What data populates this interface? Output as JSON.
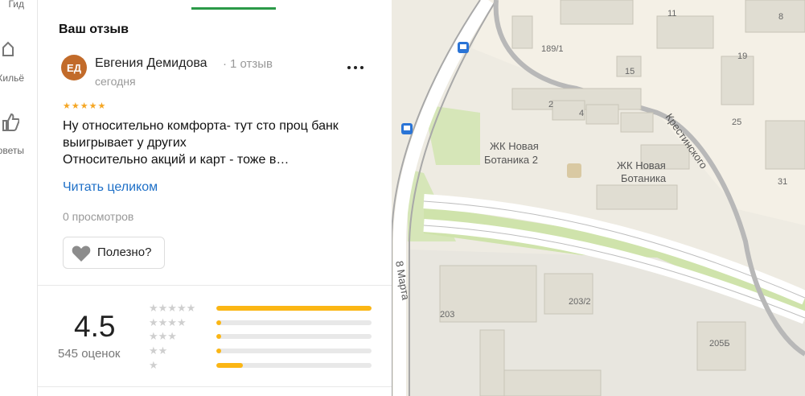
{
  "rail": {
    "items": [
      {
        "label": "Гид",
        "icon": "guide-icon"
      },
      {
        "label": "Жильё",
        "icon": "housing-icon"
      },
      {
        "label": "Советы",
        "icon": "thumbs-up-icon"
      }
    ]
  },
  "panel": {
    "title": "Ваш отзыв",
    "review": {
      "avatar_initials": "ЕД",
      "avatar_color": "#c26b2a",
      "author": "Евгения Демидова",
      "author_reviews": "1 отзыв",
      "date": "сегодня",
      "stars": "★★★★★",
      "rating": 5,
      "text_line1": "Ну относительно комфорта- тут сто проц банк",
      "text_line2": "выигрывает у других",
      "text_line3": "Относительно акций и карт - тоже в…",
      "read_more": "Читать целиком",
      "views": "0 просмотров",
      "useful_label": "Полезно?"
    },
    "summary": {
      "rating": "4.5",
      "count": "545 оценок",
      "histogram": [
        {
          "stars": "★★★★★",
          "fraction": 1.0
        },
        {
          "stars": "★★★★",
          "fraction": 0.02
        },
        {
          "stars": "★★★",
          "fraction": 0.01
        },
        {
          "stars": "★★",
          "fraction": 0.03
        },
        {
          "stars": "★",
          "fraction": 0.17
        }
      ]
    }
  },
  "map": {
    "labels": {
      "b11": "11",
      "b8": "8",
      "b189": "189/1",
      "b15": "15",
      "b19": "19",
      "b2": "2",
      "b4": "4",
      "b25": "25",
      "b31": "31",
      "street": "Крестинского",
      "jk1": "ЖК Новая",
      "jk1b": "Ботаника 2",
      "jk2": "ЖК Новая",
      "jk2b": "Ботаника",
      "street2": "8 Марта",
      "b203": "203",
      "b2032": "203/2",
      "b205": "205Б"
    }
  }
}
